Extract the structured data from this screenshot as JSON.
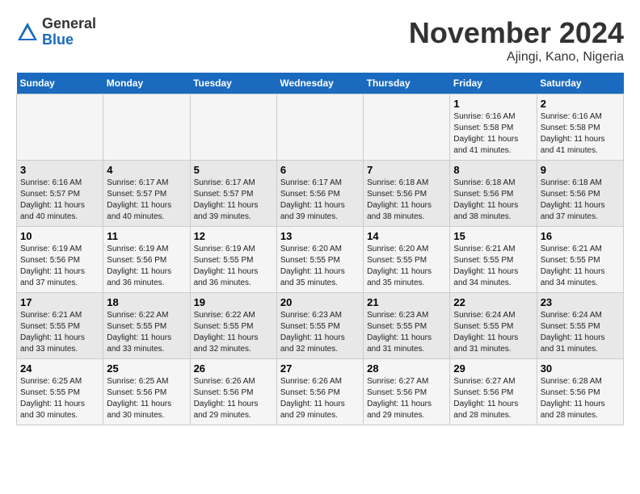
{
  "logo": {
    "general": "General",
    "blue": "Blue"
  },
  "title": "November 2024",
  "location": "Ajingi, Kano, Nigeria",
  "days_of_week": [
    "Sunday",
    "Monday",
    "Tuesday",
    "Wednesday",
    "Thursday",
    "Friday",
    "Saturday"
  ],
  "weeks": [
    [
      {
        "day": "",
        "info": ""
      },
      {
        "day": "",
        "info": ""
      },
      {
        "day": "",
        "info": ""
      },
      {
        "day": "",
        "info": ""
      },
      {
        "day": "",
        "info": ""
      },
      {
        "day": "1",
        "info": "Sunrise: 6:16 AM\nSunset: 5:58 PM\nDaylight: 11 hours and 41 minutes."
      },
      {
        "day": "2",
        "info": "Sunrise: 6:16 AM\nSunset: 5:58 PM\nDaylight: 11 hours and 41 minutes."
      }
    ],
    [
      {
        "day": "3",
        "info": "Sunrise: 6:16 AM\nSunset: 5:57 PM\nDaylight: 11 hours and 40 minutes."
      },
      {
        "day": "4",
        "info": "Sunrise: 6:17 AM\nSunset: 5:57 PM\nDaylight: 11 hours and 40 minutes."
      },
      {
        "day": "5",
        "info": "Sunrise: 6:17 AM\nSunset: 5:57 PM\nDaylight: 11 hours and 39 minutes."
      },
      {
        "day": "6",
        "info": "Sunrise: 6:17 AM\nSunset: 5:56 PM\nDaylight: 11 hours and 39 minutes."
      },
      {
        "day": "7",
        "info": "Sunrise: 6:18 AM\nSunset: 5:56 PM\nDaylight: 11 hours and 38 minutes."
      },
      {
        "day": "8",
        "info": "Sunrise: 6:18 AM\nSunset: 5:56 PM\nDaylight: 11 hours and 38 minutes."
      },
      {
        "day": "9",
        "info": "Sunrise: 6:18 AM\nSunset: 5:56 PM\nDaylight: 11 hours and 37 minutes."
      }
    ],
    [
      {
        "day": "10",
        "info": "Sunrise: 6:19 AM\nSunset: 5:56 PM\nDaylight: 11 hours and 37 minutes."
      },
      {
        "day": "11",
        "info": "Sunrise: 6:19 AM\nSunset: 5:56 PM\nDaylight: 11 hours and 36 minutes."
      },
      {
        "day": "12",
        "info": "Sunrise: 6:19 AM\nSunset: 5:55 PM\nDaylight: 11 hours and 36 minutes."
      },
      {
        "day": "13",
        "info": "Sunrise: 6:20 AM\nSunset: 5:55 PM\nDaylight: 11 hours and 35 minutes."
      },
      {
        "day": "14",
        "info": "Sunrise: 6:20 AM\nSunset: 5:55 PM\nDaylight: 11 hours and 35 minutes."
      },
      {
        "day": "15",
        "info": "Sunrise: 6:21 AM\nSunset: 5:55 PM\nDaylight: 11 hours and 34 minutes."
      },
      {
        "day": "16",
        "info": "Sunrise: 6:21 AM\nSunset: 5:55 PM\nDaylight: 11 hours and 34 minutes."
      }
    ],
    [
      {
        "day": "17",
        "info": "Sunrise: 6:21 AM\nSunset: 5:55 PM\nDaylight: 11 hours and 33 minutes."
      },
      {
        "day": "18",
        "info": "Sunrise: 6:22 AM\nSunset: 5:55 PM\nDaylight: 11 hours and 33 minutes."
      },
      {
        "day": "19",
        "info": "Sunrise: 6:22 AM\nSunset: 5:55 PM\nDaylight: 11 hours and 32 minutes."
      },
      {
        "day": "20",
        "info": "Sunrise: 6:23 AM\nSunset: 5:55 PM\nDaylight: 11 hours and 32 minutes."
      },
      {
        "day": "21",
        "info": "Sunrise: 6:23 AM\nSunset: 5:55 PM\nDaylight: 11 hours and 31 minutes."
      },
      {
        "day": "22",
        "info": "Sunrise: 6:24 AM\nSunset: 5:55 PM\nDaylight: 11 hours and 31 minutes."
      },
      {
        "day": "23",
        "info": "Sunrise: 6:24 AM\nSunset: 5:55 PM\nDaylight: 11 hours and 31 minutes."
      }
    ],
    [
      {
        "day": "24",
        "info": "Sunrise: 6:25 AM\nSunset: 5:55 PM\nDaylight: 11 hours and 30 minutes."
      },
      {
        "day": "25",
        "info": "Sunrise: 6:25 AM\nSunset: 5:56 PM\nDaylight: 11 hours and 30 minutes."
      },
      {
        "day": "26",
        "info": "Sunrise: 6:26 AM\nSunset: 5:56 PM\nDaylight: 11 hours and 29 minutes."
      },
      {
        "day": "27",
        "info": "Sunrise: 6:26 AM\nSunset: 5:56 PM\nDaylight: 11 hours and 29 minutes."
      },
      {
        "day": "28",
        "info": "Sunrise: 6:27 AM\nSunset: 5:56 PM\nDaylight: 11 hours and 29 minutes."
      },
      {
        "day": "29",
        "info": "Sunrise: 6:27 AM\nSunset: 5:56 PM\nDaylight: 11 hours and 28 minutes."
      },
      {
        "day": "30",
        "info": "Sunrise: 6:28 AM\nSunset: 5:56 PM\nDaylight: 11 hours and 28 minutes."
      }
    ]
  ]
}
